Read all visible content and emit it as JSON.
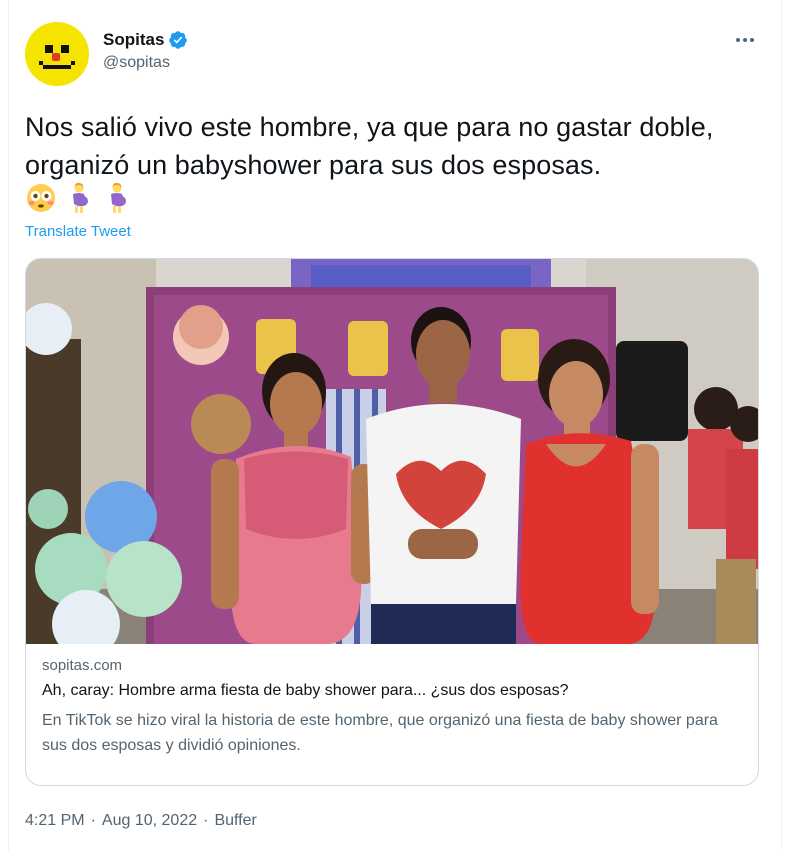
{
  "author": {
    "display_name": "Sopitas",
    "handle": "@sopitas",
    "verified": true,
    "avatar_icon": "pixel-smiley-face-icon",
    "avatar_color": "#f5e400"
  },
  "header": {
    "more_icon": "more-horizontal-icon"
  },
  "tweet": {
    "text": "Nos salió vivo este hombre, ya que para no gastar doble, organizó un babyshower para sus dos esposas.",
    "emojis": [
      "flushed-face-emoji",
      "pregnant-woman-emoji",
      "pregnant-woman-emoji"
    ],
    "translate_label": "Translate Tweet"
  },
  "card": {
    "image_icon": "photo-of-man-with-two-pregnant-women",
    "domain": "sopitas.com",
    "title": "Ah, caray: Hombre arma fiesta de baby shower para... ¿sus dos esposas?",
    "description": "En TikTok se hizo viral la historia de este hombre, que organizó una fiesta de baby shower para sus dos esposas y dividió opiniones."
  },
  "meta": {
    "time": "4:21 PM",
    "separator": "·",
    "date": "Aug 10, 2022",
    "source": "Buffer"
  },
  "colors": {
    "link_blue": "#1d9bf0",
    "secondary_text": "#536471",
    "primary_text": "#0f1419",
    "border": "#cfd9de"
  }
}
